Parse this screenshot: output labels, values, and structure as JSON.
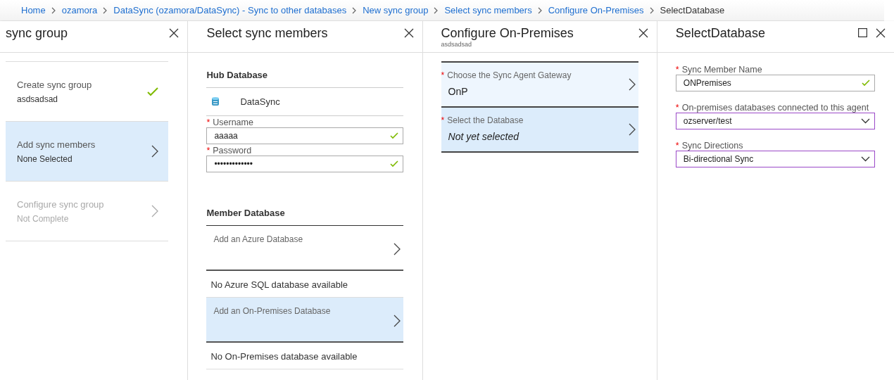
{
  "breadcrumb": [
    {
      "label": "Home",
      "current": false
    },
    {
      "label": "ozamora",
      "current": false
    },
    {
      "label": "DataSync (ozamora/DataSync) - Sync to other databases",
      "current": false
    },
    {
      "label": "New sync group",
      "current": false
    },
    {
      "label": "Select sync members",
      "current": false
    },
    {
      "label": "Configure On-Premises",
      "current": false
    },
    {
      "label": "SelectDatabase",
      "current": true
    }
  ],
  "steps_panel": {
    "title": "sync group",
    "steps": [
      {
        "title": "Create sync group",
        "subtitle": "asdsadsad",
        "completed": true,
        "selected": false,
        "disabled": false
      },
      {
        "title": "Add sync members",
        "subtitle": "None Selected",
        "completed": false,
        "selected": true,
        "disabled": false
      },
      {
        "title": "Configure sync group",
        "subtitle": "Not Complete",
        "completed": false,
        "selected": false,
        "disabled": true
      }
    ]
  },
  "members_panel": {
    "title": "Select sync members",
    "hub_heading": "Hub Database",
    "hub_name": "DataSync",
    "fields": [
      {
        "label": "Username",
        "required_mark": "*",
        "value": "aaaaa",
        "valid": true
      },
      {
        "label": "Password",
        "required_mark": "*",
        "value": "•••••••••••••",
        "valid": true
      }
    ],
    "member_heading": "Member Database",
    "options": [
      {
        "label": "Add an Azure Database",
        "selected": false,
        "note": "No Azure SQL database available"
      },
      {
        "label": "Add an On-Premises Database",
        "selected": true,
        "note": "No On-Premises database available"
      }
    ]
  },
  "configure_panel": {
    "title": "Configure On-Premises",
    "subtitle": "asdsadsad",
    "rows": [
      {
        "label": "Choose the Sync Agent Gateway",
        "required_mark": "*",
        "value": "OnP",
        "empty": false,
        "selected": false
      },
      {
        "label": "Select the Database",
        "required_mark": "*",
        "value": "Not yet selected",
        "empty": true,
        "selected": true
      }
    ]
  },
  "select_panel": {
    "title": "SelectDatabase",
    "fields": [
      {
        "kind": "text",
        "label": "Sync Member Name",
        "required_mark": "*",
        "value": "ONPremises",
        "valid": true
      },
      {
        "kind": "dropdown",
        "label": "On-premises databases connected to this agent",
        "required_mark": "*",
        "value": "ozserver/test"
      },
      {
        "kind": "dropdown",
        "label": "Sync Directions",
        "required_mark": "*",
        "value": "Bi-directional Sync"
      }
    ]
  }
}
